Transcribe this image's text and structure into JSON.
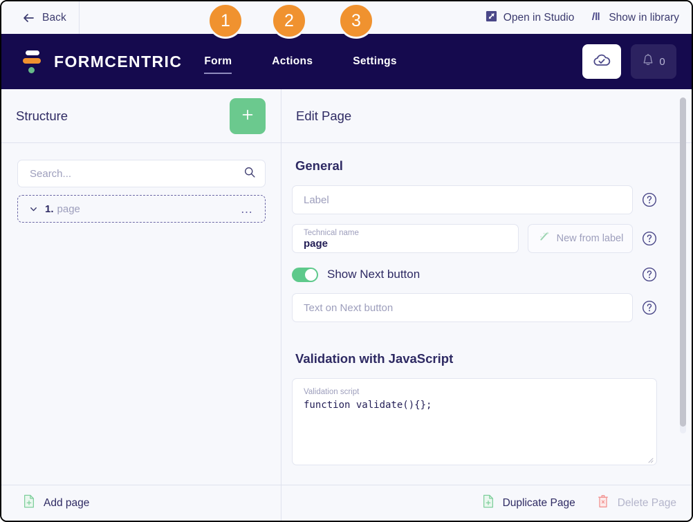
{
  "topbar": {
    "back_label": "Back",
    "back_icon": "arrow-left-icon",
    "actions": [
      {
        "label": "Open in Studio",
        "icon": "open-in-studio-icon"
      },
      {
        "label": "Show in library",
        "icon": "library-bars-icon"
      }
    ]
  },
  "navbar": {
    "brand": "FORMCENTRIC",
    "logo_icon": "formcentric-logo-icon",
    "tabs": [
      {
        "label": "Form",
        "active": true
      },
      {
        "label": "Actions",
        "active": false
      },
      {
        "label": "Settings",
        "active": false
      }
    ],
    "publish_icon": "cloud-check-icon",
    "notifications_icon": "bell-icon",
    "notifications_count": "0"
  },
  "badges": [
    {
      "number": "1"
    },
    {
      "number": "2"
    },
    {
      "number": "3"
    }
  ],
  "structure": {
    "title": "Structure",
    "add_icon": "plus-icon",
    "search": {
      "value": "",
      "placeholder": "Search..."
    },
    "search_icon": "search-icon",
    "tree": [
      {
        "index": "1.",
        "name": "page",
        "chevron": "chevron-down-icon",
        "more": "…"
      }
    ]
  },
  "edit_page": {
    "title": "Edit Page",
    "general_title": "General",
    "label_field": {
      "value": "",
      "placeholder": "Label"
    },
    "technical_name": {
      "mini_label": "Technical name",
      "value": "page"
    },
    "new_from_label": {
      "label": "New from label",
      "icon": "magic-wand-icon"
    },
    "show_next_button": {
      "label": "Show Next button",
      "enabled": true
    },
    "next_button_text": {
      "value": "",
      "placeholder": "Text on Next button"
    },
    "validation_title": "Validation with JavaScript",
    "validation_script": {
      "mini_label": "Validation script",
      "value": "function validate(){};"
    },
    "help_icon": "help-circle-icon"
  },
  "footer": {
    "add_page": {
      "label": "Add page",
      "icon": "document-plus-icon"
    },
    "duplicate_page": {
      "label": "Duplicate Page",
      "icon": "document-plus-icon"
    },
    "delete_page": {
      "label": "Delete Page",
      "icon": "trash-x-icon",
      "disabled": true
    }
  },
  "colors": {
    "navy": "#150a4e",
    "orange": "#f0922f",
    "green": "#6bc98e",
    "page_bg": "#f7f8fc"
  }
}
